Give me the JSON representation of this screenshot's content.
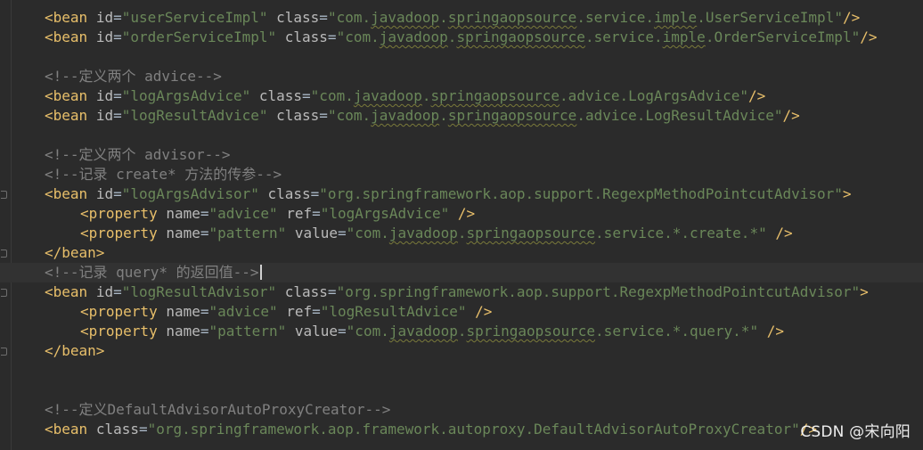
{
  "code_lines": [
    "<bean id=\"userServiceImpl\" class=\"com.javadoop.springaopsource.service.imple.UserServiceImpl\"/>",
    "<bean id=\"orderServiceImpl\" class=\"com.javadoop.springaopsource.service.imple.OrderServiceImpl\"/>",
    "",
    "<!--定义两个 advice-->",
    "<bean id=\"logArgsAdvice\" class=\"com.javadoop.springaopsource.advice.LogArgsAdvice\"/>",
    "<bean id=\"logResultAdvice\" class=\"com.javadoop.springaopsource.advice.LogResultAdvice\"/>",
    "",
    "<!--定义两个 advisor-->",
    "<!--记录 create* 方法的传参-->",
    "<bean id=\"logArgsAdvisor\" class=\"org.springframework.aop.support.RegexpMethodPointcutAdvisor\">",
    "<property name=\"advice\" ref=\"logArgsAdvice\" />",
    "<property name=\"pattern\" value=\"com.javadoop.springaopsource.service.*.create.*\" />",
    "</bean>",
    "<!--记录 query* 的返回值-->",
    "<bean id=\"logResultAdvisor\" class=\"org.springframework.aop.support.RegexpMethodPointcutAdvisor\">",
    "<property name=\"advice\" ref=\"logResultAdvice\" />",
    "<property name=\"pattern\" value=\"com.javadoop.springaopsource.service.*.query.*\" />",
    "</bean>",
    "",
    "",
    "<!--定义DefaultAdvisorAutoProxyCreator-->",
    "<bean class=\"org.springframework.aop.framework.autoproxy.DefaultAdvisorAutoProxyCreator\"/>"
  ],
  "watermark": "CSDN @宋向阳",
  "colors": {
    "background": "#2b2b2b",
    "tag": "#e8bf6a",
    "attribute": "#bababa",
    "value": "#6a8759",
    "comment": "#808080"
  }
}
